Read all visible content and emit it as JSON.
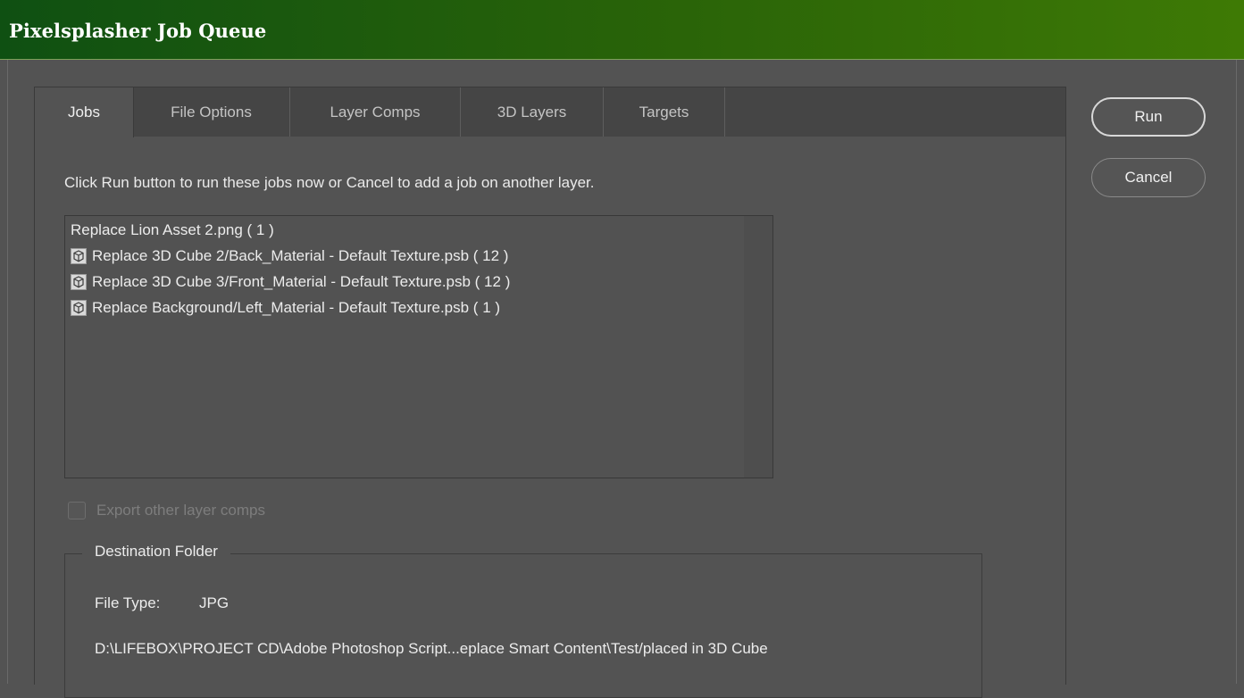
{
  "window": {
    "title": "Pixelsplasher Job Queue"
  },
  "tabs": [
    {
      "label": "Jobs",
      "active": true
    },
    {
      "label": "File Options",
      "active": false
    },
    {
      "label": "Layer Comps",
      "active": false
    },
    {
      "label": "3D Layers",
      "active": false
    },
    {
      "label": "Targets",
      "active": false
    }
  ],
  "jobs_tab": {
    "instructions": "Click Run button to run these jobs now or Cancel to add a job on another layer.",
    "job_list": [
      {
        "label": "Replace Lion Asset 2.png ( 1 )",
        "icon": ""
      },
      {
        "label": "Replace 3D Cube 2/Back_Material - Default Texture.psb ( 12 )",
        "icon": "3d-cube-icon"
      },
      {
        "label": "Replace 3D Cube 3/Front_Material - Default Texture.psb ( 12 )",
        "icon": "3d-cube-icon"
      },
      {
        "label": "Replace Background/Left_Material - Default Texture.psb ( 1 )",
        "icon": "3d-cube-icon"
      }
    ],
    "export_other_layer_comps": {
      "label": "Export other layer comps",
      "checked": false,
      "enabled": false
    },
    "destination": {
      "legend": "Destination Folder",
      "file_type_label": "File Type:",
      "file_type_value": "JPG",
      "path": "D:\\LIFEBOX\\PROJECT CD\\Adobe Photoshop Script...eplace Smart Content\\Test/placed in 3D Cube"
    }
  },
  "buttons": {
    "run": "Run",
    "cancel": "Cancel"
  },
  "colors": {
    "titlebar_start": "#0f5012",
    "titlebar_end": "#3e7a05",
    "panel_bg": "#535353",
    "tabstrip_bg": "#454545"
  }
}
